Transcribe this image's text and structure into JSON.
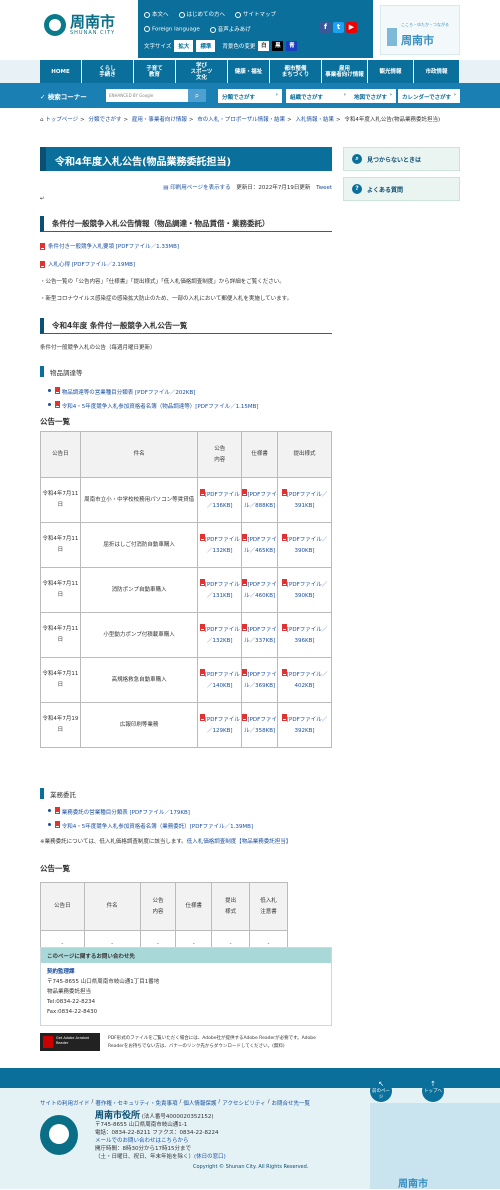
{
  "header": {
    "logo_name": "周南市",
    "logo_sub": "SHUNAN CITY",
    "links": [
      "本文へ",
      "はじめての方へ",
      "サイトマップ"
    ],
    "foreign": "Foreign language",
    "voice": "音声よみあげ",
    "font_size_label": "文字サイズ",
    "font_large": "拡大",
    "font_std": "標準",
    "bg_label": "背景色の変更",
    "bg_white": "白",
    "bg_black": "黒",
    "bg_blue": "青",
    "right_logo": "周南市",
    "right_slogan": "こころ・ゆたか・つながる"
  },
  "nav": [
    "HOME",
    "くらし\n手続き",
    "子育て\n教育",
    "学び\nスポーツ\n文化",
    "健康・福祉",
    "都市整備\nまちづくり",
    "雇用\n事業者向け情報",
    "観光情報",
    "市政情報"
  ],
  "search": {
    "label": "検索コーナー",
    "placeholder": "ENHANCED BY Google",
    "categories": [
      "分類でさがす",
      "組織でさがす",
      "地図でさがす",
      "カレンダーでさがす"
    ]
  },
  "breadcrumb": [
    "トップページ",
    "分類でさがす",
    "雇用・事業者向け情報",
    "市の入札・プロポーザル情報・結果",
    "入札情報・結果",
    "令和4年度入札公告(物品業務委託担当)"
  ],
  "page": {
    "title": "令和4年度入札公告(物品業務委託担当)",
    "print": "印刷用ページを表示する",
    "updated": "更新日：2022年7月19日更新",
    "tweet": "Tweet",
    "mark": "↵",
    "section1": "条件付一般競争入札公告情報（物品調達・物品賃借・業務委託）",
    "pdf1": "条件付き一般競争入札要領 [PDFファイル／1.33MB]",
    "pdf2": "入札心得 [PDFファイル／2.19MB]",
    "note1": "・公告一覧の「公告内容」「仕様書」「提出様式」「低入札価格調査制度」から詳細をご覧ください。",
    "note2": "・新型コロナウイルス感染症の感染拡大防止のため、一部の入札において郵便入札を実施しています。",
    "section2": "令和4年度 条件付一般競争入札公告一覧",
    "section2_note": "条件付一般競争入札の公告（毎週月曜日更新）",
    "goods_head": "物品調達等",
    "goods_links": [
      "物品調達等の営業種目分類表 [PDFファイル／202KB]",
      "令和4・5年度競争入札参加資格者名簿（物品調達等）[PDFファイル／1.15MB]"
    ],
    "list_head": "公告一覧",
    "table_headers": [
      "公告日",
      "件名",
      "公告\n内容",
      "仕様書",
      "提出様式"
    ],
    "rows": [
      {
        "date": "令和4年7月11日",
        "name": "周南市立小・中学校校務用パソコン等賃貸借",
        "c": "[PDFファイル／136KB]",
        "s": "[PDFファイル／888KB]",
        "f": "[PDFファイル／391KB]"
      },
      {
        "date": "令和4年7月11日",
        "name": "屈折はしご付消防自動車購入",
        "c": "[PDFファイル／132KB]",
        "s": "[PDFファイル／465KB]",
        "f": "[PDFファイル／390KB]"
      },
      {
        "date": "令和4年7月11日",
        "name": "消防ポンプ自動車購入",
        "c": "[PDFファイル／131KB]",
        "s": "[PDFファイル／460KB]",
        "f": "[PDFファイル／390KB]"
      },
      {
        "date": "令和4年7月11日",
        "name": "小型動力ポンプ付積載車購入",
        "c": "[PDFファイル／132KB]",
        "s": "[PDFファイル／337KB]",
        "f": "[PDFファイル／396KB]"
      },
      {
        "date": "令和4年7月11日",
        "name": "高規格救急自動車購入",
        "c": "[PDFファイル／140KB]",
        "s": "[PDFファイル／369KB]",
        "f": "[PDFファイル／402KB]"
      },
      {
        "date": "令和4年7月19日",
        "name": "広報印刷等業務",
        "c": "[PDFファイル／129KB]",
        "s": "[PDFファイル／358KB]",
        "f": "[PDFファイル／392KB]"
      }
    ],
    "service_head": "業務委託",
    "service_links": [
      "業務委託の営業種目分類表 [PDFファイル／179KB]",
      "令和4・5年度競争入札参加資格者名簿（業務委託）[PDFファイル／1.39MB]"
    ],
    "service_note": "※業務委託については、低入札価格調査制度に該当します。",
    "service_note_link": "低入札価格調査制度【物品業務委託担当】",
    "list2_head": "公告一覧",
    "table2_headers": [
      "公告日",
      "件名",
      "公告\n内容",
      "仕様書",
      "提出\n様式",
      "低入札\n注意書"
    ],
    "table2_row": [
      "-",
      "-",
      "-",
      "-",
      "-",
      "-"
    ]
  },
  "side": [
    "見つからないときは",
    "よくある質問"
  ],
  "contact": {
    "head": "このページに関するお問い合わせ先",
    "dept": "契約監理課",
    "addr": "〒745-8655 山口県周南市岐山通1丁目1番地",
    "sub": "物品業務委託担当",
    "tel": "Tel:0834-22-8234",
    "fax": "Fax:0834-22-8430"
  },
  "adobe": {
    "badge": "Get Adobe Acrobat Reader",
    "text": "PDF形式のファイルをご覧いただく場合には、Adobe社が提供するAdobe Readerが必要です。Adobe Readerをお持ちでない方は、バナーのリンク先からダウンロードしてください。(無料)"
  },
  "footer": {
    "links": [
      "サイトの利用ガイド",
      "著作権・セキュリティ・免責事項",
      "個人情報保護",
      "アクセシビリティ",
      "お問合せ先一覧"
    ],
    "prev": "前のページ",
    "top": "トップへ",
    "name": "周南市役所",
    "corp": "(法人番号4000020352152)",
    "addr": "〒745-8655 山口県周南市岐山通1-1",
    "tel": "電話：0834-22-8211 ファクス：0834-22-8224",
    "mail": "メールでのお問い合わせはこちらから",
    "hours": "開庁時間：8時30分から17時15分まで",
    "closed": "（土・日曜日、祝日、年末年始を除く）",
    "holiday": "(休日の窓口)",
    "copyright": "Copyright © Shunan City. All Rights Reserved.",
    "map_label": "周南市"
  }
}
